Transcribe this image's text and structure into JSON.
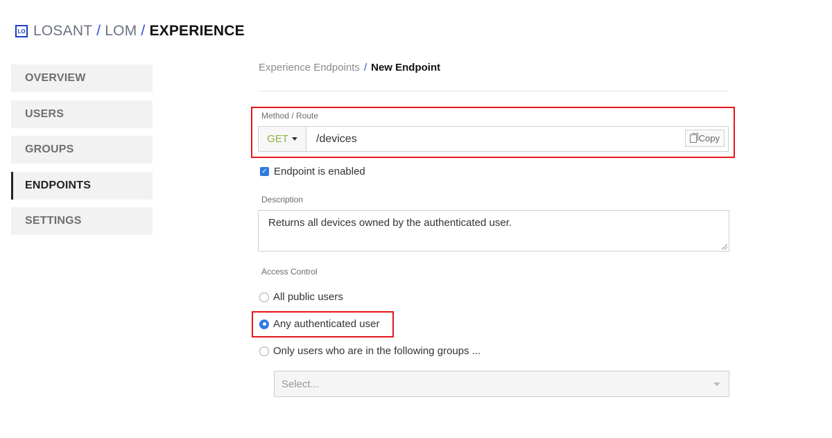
{
  "header": {
    "logo_text": "LO",
    "crumbs": [
      "LOSANT",
      "LOM",
      "EXPERIENCE"
    ],
    "separator": "/"
  },
  "sidebar": {
    "items": [
      {
        "label": "OVERVIEW"
      },
      {
        "label": "USERS"
      },
      {
        "label": "GROUPS"
      },
      {
        "label": "ENDPOINTS",
        "active": true
      },
      {
        "label": "SETTINGS"
      }
    ]
  },
  "breadcrumb": {
    "parent": "Experience Endpoints",
    "separator": "/",
    "current": "New Endpoint"
  },
  "form": {
    "method_route_label": "Method / Route",
    "method": "GET",
    "route": "/devices",
    "copy_label": "Copy",
    "enabled_label": "Endpoint is enabled",
    "enabled_checked": "✓",
    "description_label": "Description",
    "description": "Returns all devices owned by the authenticated user.",
    "access_control_label": "Access Control",
    "access_options": [
      {
        "label": "All public users"
      },
      {
        "label": "Any authenticated user",
        "selected": true
      },
      {
        "label": "Only users who are in the following groups ..."
      }
    ],
    "groups_placeholder": "Select..."
  },
  "colors": {
    "accent": "#2f7be0",
    "highlight": "#e3161b",
    "method_green": "#8bb33f",
    "breadcrumb_sep": "#2b50d6"
  }
}
